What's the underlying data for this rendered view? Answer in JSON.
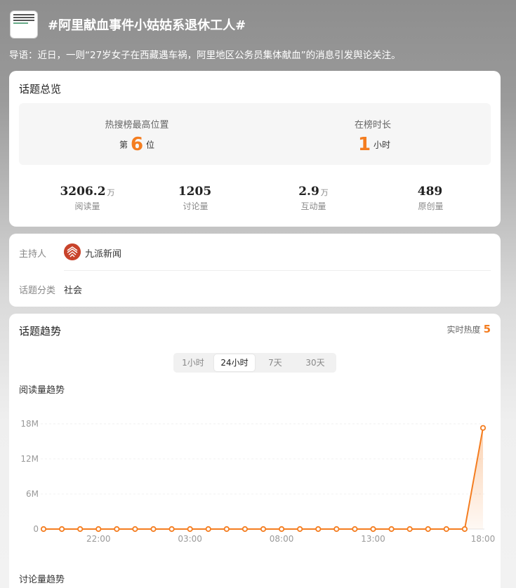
{
  "header": {
    "topic_title": "#阿里献血事件小姑姑系退休工人#",
    "intro": "导语：近日，一则“27岁女子在西藏遇车祸，阿里地区公务员集体献血”的消息引发舆论关注。"
  },
  "overview": {
    "title": "话题总览",
    "rank_label": "热搜榜最高位置",
    "rank_prefix": "第",
    "rank_value": "6",
    "rank_suffix": "位",
    "duration_label": "在榜时长",
    "duration_value": "1",
    "duration_unit": "小时",
    "stats": [
      {
        "value": "3206.2",
        "unit": "万",
        "label": "阅读量"
      },
      {
        "value": "1205",
        "unit": "",
        "label": "讨论量"
      },
      {
        "value": "2.9",
        "unit": "万",
        "label": "互动量"
      },
      {
        "value": "489",
        "unit": "",
        "label": "原创量"
      }
    ]
  },
  "host": {
    "host_label": "主持人",
    "host_name": "九派新闻",
    "category_label": "话题分类",
    "category_value": "社会"
  },
  "trend": {
    "title": "话题趋势",
    "heat_label": "实时热度",
    "heat_value": "5",
    "tabs": [
      "1小时",
      "24小时",
      "7天",
      "30天"
    ],
    "active_tab": "24小时",
    "read_section_label": "阅读量趋势",
    "discuss_section_label": "讨论量趋势"
  },
  "colors": {
    "accent": "#f47d20"
  },
  "chart_data": {
    "type": "area",
    "title": "阅读量趋势",
    "xlabel": "",
    "ylabel": "",
    "x_ticks": [
      "22:00",
      "03:00",
      "08:00",
      "13:00",
      "18:00"
    ],
    "y_ticks": [
      "0",
      "6M",
      "12M",
      "18M"
    ],
    "ylim": [
      0,
      18000000
    ],
    "grid": true,
    "series": [
      {
        "values": [
          0,
          0,
          0,
          0,
          0,
          0,
          0,
          0,
          0,
          0,
          0,
          0,
          0,
          0,
          0,
          0,
          0,
          0,
          0,
          0,
          0,
          0,
          0,
          0,
          17300000
        ]
      }
    ]
  }
}
